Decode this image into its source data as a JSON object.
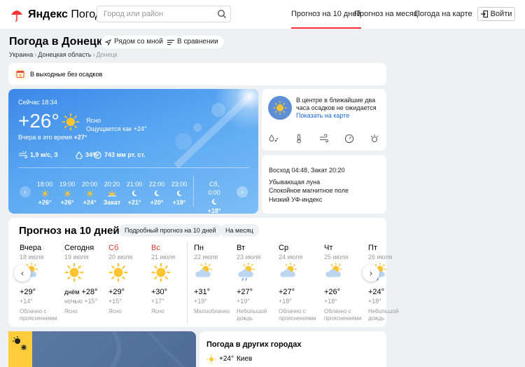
{
  "header": {
    "logo_brand": "Яндекс",
    "logo_product": "Погода",
    "search_placeholder": "Город или район",
    "nav": [
      {
        "label": "Прогноз на 10 дней",
        "active": true
      },
      {
        "label": "Прогноз на месяц",
        "active": false
      },
      {
        "label": "Погода на карте",
        "active": false
      }
    ],
    "login_label": "Войти"
  },
  "page": {
    "title": "Погода в Донецке",
    "nearby_label": "Рядом со мной",
    "compare_label": "В сравнении",
    "breadcrumbs": [
      "Украина",
      "Донецкая область",
      "Донецк"
    ]
  },
  "alert": {
    "text": "В выходные без осадков"
  },
  "current": {
    "time_label": "Сейчас 18:34",
    "temp": "+26°",
    "condition": "Ясно",
    "feels_like": "Ощущается как +24°",
    "yesterday_prefix": "Вчера в это время",
    "yesterday_temp": "+27°",
    "wind": "1,9 м/с, З",
    "humidity": "34%",
    "pressure": "743 мм рт. ст."
  },
  "hourly": [
    {
      "time": "18:00",
      "icon": "sun-icon",
      "temp": "+26°"
    },
    {
      "time": "19:00",
      "icon": "sun-icon",
      "temp": "+26°"
    },
    {
      "time": "20:00",
      "icon": "sun-icon",
      "temp": "+24°"
    },
    {
      "time": "20:20",
      "icon": "sunset-icon",
      "temp": "Закат"
    },
    {
      "time": "21:00",
      "icon": "moon-icon",
      "temp": "+21°"
    },
    {
      "time": "22:00",
      "icon": "moon-icon",
      "temp": "+20°"
    },
    {
      "time": "23:00",
      "icon": "moon-icon",
      "temp": "+19°"
    },
    {
      "time": "Сб, 0:00",
      "icon": "moon-icon",
      "temp": "+18°"
    }
  ],
  "nowcast": {
    "text": "В центре в ближайшие два часа осадков не ожидается",
    "link": "Показать на карте"
  },
  "astro": {
    "sun": "Восход 04:48, Закат 20:20",
    "moon": "Убывающая луна",
    "magnetic": "Спокойное магнитное поле",
    "uv": "Низкий УФ-индекс"
  },
  "forecast": {
    "title": "Прогноз на 10 дней",
    "detail_label": "Подробный прогноз на 10 дней",
    "month_label": "На месяц",
    "days": [
      {
        "name": "Вчера",
        "date": "18 июля",
        "weekend": false,
        "icon": "partly-cloudy-icon",
        "high": "+29°",
        "high_prefix": "",
        "low": "+14°",
        "low_prefix": "",
        "cond": "Облачно с прояснениями"
      },
      {
        "name": "Сегодня",
        "date": "19 июля",
        "weekend": false,
        "icon": "sun-icon",
        "high": "+28°",
        "high_prefix": "днём",
        "low": "+15°",
        "low_prefix": "ночью",
        "cond": "Ясно"
      },
      {
        "name": "Сб",
        "date": "20 июля",
        "weekend": true,
        "icon": "sun-icon",
        "high": "+29°",
        "high_prefix": "",
        "low": "+15°",
        "low_prefix": "",
        "cond": "Ясно"
      },
      {
        "name": "Вс",
        "date": "21 июля",
        "weekend": true,
        "icon": "sun-icon",
        "high": "+30°",
        "high_prefix": "",
        "low": "+17°",
        "low_prefix": "",
        "cond": "Ясно"
      },
      {
        "name": "Пн",
        "date": "22 июля",
        "weekend": false,
        "icon": "partly-cloudy-icon",
        "high": "+31°",
        "high_prefix": "",
        "low": "+19°",
        "low_prefix": "",
        "cond": "Малооблачно"
      },
      {
        "name": "Вт",
        "date": "23 июля",
        "weekend": false,
        "icon": "light-rain-icon",
        "high": "+27°",
        "high_prefix": "",
        "low": "+19°",
        "low_prefix": "",
        "cond": "Небольшой дождь"
      },
      {
        "name": "Ср",
        "date": "24 июля",
        "weekend": false,
        "icon": "partly-cloudy-icon",
        "high": "+27°",
        "high_prefix": "",
        "low": "+18°",
        "low_prefix": "",
        "cond": "Облачно с прояснениями"
      },
      {
        "name": "Чт",
        "date": "25 июля",
        "weekend": false,
        "icon": "partly-cloudy-icon",
        "high": "+26°",
        "high_prefix": "",
        "low": "+18°",
        "low_prefix": "",
        "cond": "Облачно с прояснениями"
      },
      {
        "name": "Пт",
        "date": "26 июля",
        "weekend": false,
        "icon": "light-rain-icon",
        "high": "+24°",
        "high_prefix": "",
        "low": "+18°",
        "low_prefix": "",
        "cond": "Небольшой дождь"
      }
    ]
  },
  "cities": {
    "title": "Погода в других городах",
    "items": [
      {
        "temp": "+24°",
        "name": "Киев",
        "icon": "sun-icon"
      }
    ]
  },
  "colors": {
    "accent": "#ff3333",
    "sun": "#ffc531",
    "link": "#1a6bd6",
    "weekend": "#e03a2a"
  }
}
